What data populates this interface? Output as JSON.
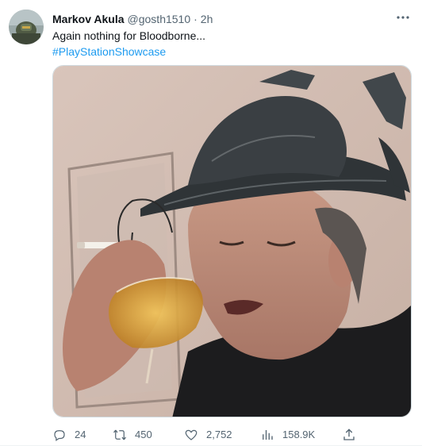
{
  "tweet": {
    "author_name": "Markov Akula",
    "handle": "@gosth1510",
    "separator": "·",
    "time": "2h",
    "text_line1": "Again nothing for Bloodborne...",
    "hashtag": "#PlayStationShowcase"
  },
  "actions": {
    "replies": "24",
    "retweets": "450",
    "likes": "2,752",
    "views": "158.9K"
  },
  "colors": {
    "accent": "#1d9bf0",
    "secondary_text": "#536471",
    "primary_text": "#0f1419"
  },
  "icons": {
    "more": "more-icon",
    "reply": "reply-icon",
    "retweet": "retweet-icon",
    "like": "heart-icon",
    "views": "views-icon",
    "share": "share-icon"
  }
}
